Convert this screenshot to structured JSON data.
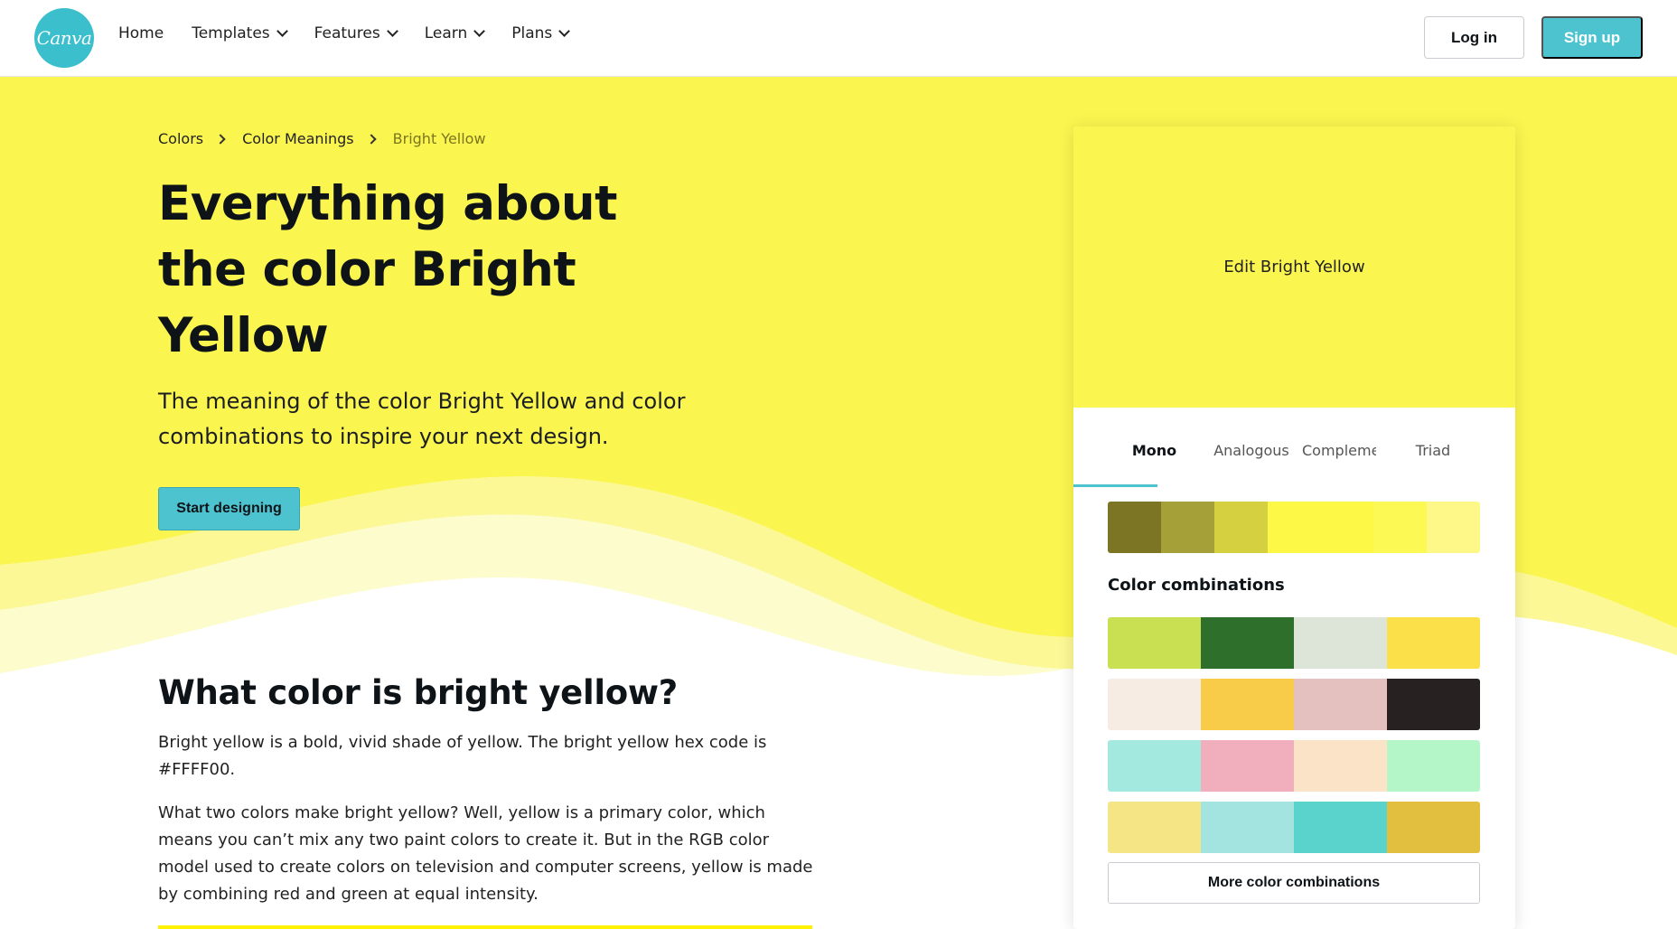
{
  "header": {
    "logo_text": "Canva",
    "nav": [
      {
        "label": "Home",
        "dropdown": false
      },
      {
        "label": "Templates",
        "dropdown": true
      },
      {
        "label": "Features",
        "dropdown": true
      },
      {
        "label": "Learn",
        "dropdown": true
      },
      {
        "label": "Plans",
        "dropdown": true
      }
    ],
    "login_label": "Log in",
    "signup_label": "Sign up"
  },
  "breadcrumb": {
    "items": [
      "Colors",
      "Color Meanings",
      "Bright Yellow"
    ]
  },
  "hero": {
    "title": "Everything about the color Bright Yellow",
    "subtitle": "The meaning of the color Bright Yellow and color combinations to inspire your next design.",
    "cta_label": "Start designing"
  },
  "content": {
    "section_title": "What color is bright yellow?",
    "paragraph_1": "Bright yellow is a bold, vivid shade of yellow. The bright yellow hex code is #FFFF00.",
    "paragraph_2": "What two colors make bright yellow? Well, yellow is a primary color, which means you can’t mix any two paint colors to create it. But in the RGB color model used to create colors on television and computer screens, yellow is made by combining red and green at equal intensity."
  },
  "color_card": {
    "edit_label": "Edit Bright Yellow",
    "main_color": "#fbf64f",
    "tabs": [
      "Mono",
      "Analogous",
      "Complementary",
      "Triad"
    ],
    "active_tab": "Mono",
    "mono_shades": [
      "#7b7524",
      "#a6a038",
      "#d4d040",
      "#fdf846",
      "#fdf846",
      "#fdf954",
      "#fef888"
    ],
    "combinations_title": "Color combinations",
    "combinations": [
      [
        "#c8e052",
        "#2e6f2c",
        "#dde4d8",
        "#fbe04a"
      ],
      [
        "#f7ece3",
        "#f8cc48",
        "#e4c1be",
        "#272221"
      ],
      [
        "#a3e9e0",
        "#f1afbd",
        "#fbe3c7",
        "#b5f6c9"
      ],
      [
        "#f6e585",
        "#a3e4e0",
        "#5bd3cd",
        "#e3bf40"
      ]
    ],
    "more_label": "More color combinations"
  },
  "colors": {
    "accent_teal": "#4cc3cf",
    "hero_yellow": "#fbf64f"
  }
}
